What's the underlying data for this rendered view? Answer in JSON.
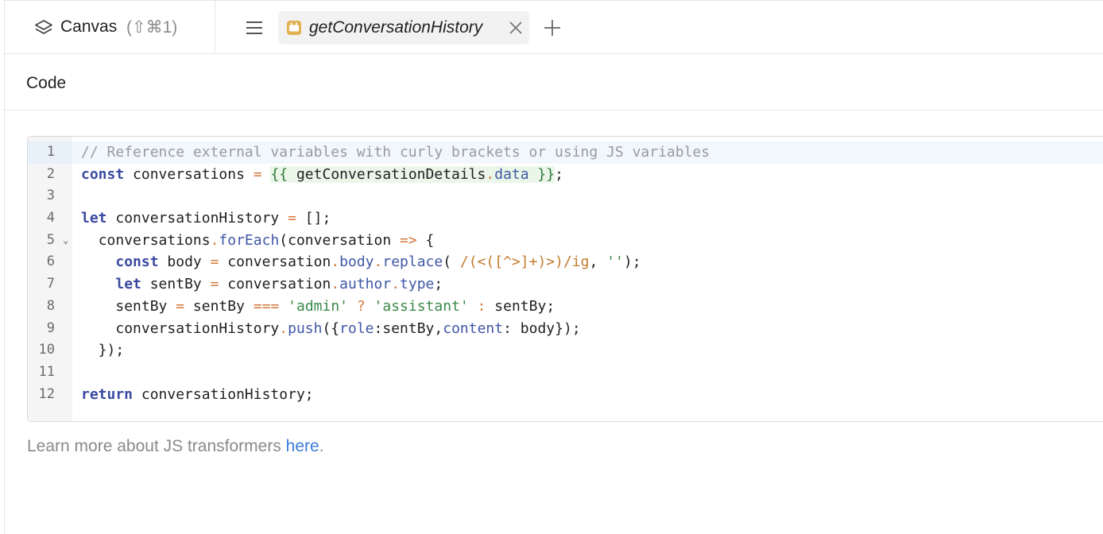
{
  "topbar": {
    "canvas_label": "Canvas",
    "canvas_shortcut": "(⇧⌘1)",
    "tab_name": "getConversationHistory",
    "colors": {
      "query_icon": "#e0b251"
    }
  },
  "section": {
    "title": "Code"
  },
  "editor": {
    "lines": [
      {
        "n": "1"
      },
      {
        "n": "2"
      },
      {
        "n": "3"
      },
      {
        "n": "4"
      },
      {
        "n": "5"
      },
      {
        "n": "6"
      },
      {
        "n": "7"
      },
      {
        "n": "8"
      },
      {
        "n": "9"
      },
      {
        "n": "10"
      },
      {
        "n": "11"
      },
      {
        "n": "12"
      }
    ],
    "fold_marker": "⌄",
    "code": {
      "l1": "// Reference external variables with curly brackets or using JS variables",
      "const": "const",
      "let": "let",
      "return": "return",
      "conversations": "conversations",
      "conversationHistory": "conversationHistory",
      "getConversationDetails": "getConversationDetails",
      "data": "data",
      "forEach": "forEach",
      "conversation": "conversation",
      "body": "body",
      "replace": "replace",
      "regex": "/(<([^>]+)>)/ig",
      "empty_str": "''",
      "sentBy": "sentBy",
      "author": "author",
      "type": "type",
      "admin": "'admin'",
      "assistant": "'assistant'",
      "push": "push",
      "role": "role",
      "content": "content"
    }
  },
  "footer": {
    "learn_text": "Learn more about JS transformers ",
    "link_text": "here",
    "period": "."
  }
}
